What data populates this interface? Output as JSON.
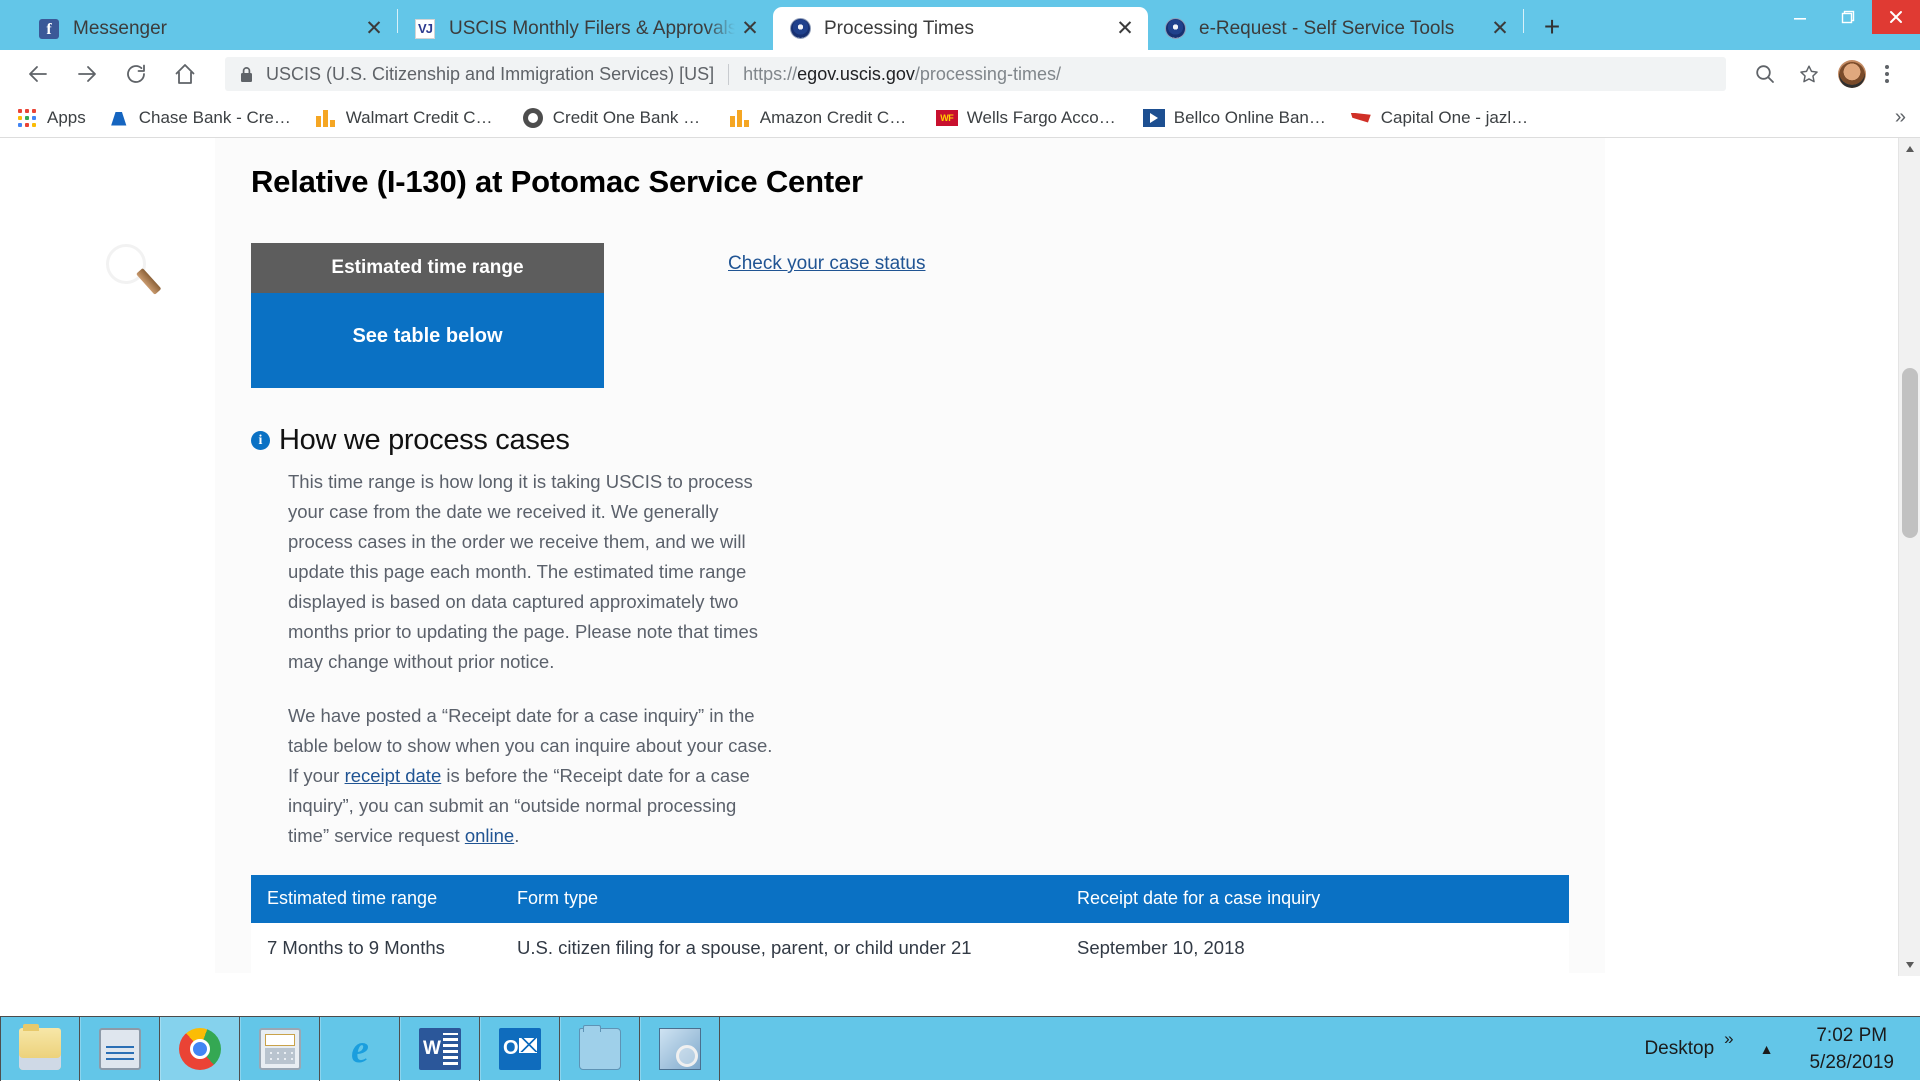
{
  "browser": {
    "tabs": [
      {
        "title": "Messenger",
        "icon": "facebook-icon",
        "active": false
      },
      {
        "title": "USCIS Monthly Filers & Approvals",
        "icon": "vj-icon",
        "active": false
      },
      {
        "title": "Processing Times",
        "icon": "dhs-seal-icon",
        "active": true
      },
      {
        "title": "e-Request - Self Service Tools",
        "icon": "dhs-seal-icon",
        "active": false
      }
    ],
    "new_tab_label": "+",
    "close_label": "✕",
    "window_controls": {
      "minimize": "minimize-icon",
      "maximize": "maximize-icon",
      "close": "close-icon"
    },
    "omnibox": {
      "site_identity": "USCIS (U.S. Citizenship and Immigration Services) [US]",
      "url_scheme": "https://",
      "url_host": "egov.uscis.gov",
      "url_path": "/processing-times/",
      "lock_icon": "lock-icon",
      "zoom_icon": "search-zoom-icon",
      "bookmark_icon": "star-icon",
      "menu_icon": "three-dots-menu-icon"
    },
    "bookmarks": {
      "apps_label": "Apps",
      "items": [
        {
          "label": "Chase Bank - Credit...",
          "icon": "chase-icon"
        },
        {
          "label": "Walmart Credit Car...",
          "icon": "walmart-icon"
        },
        {
          "label": "Credit One Bank Of...",
          "icon": "credit-one-icon"
        },
        {
          "label": "Amazon Credit Car...",
          "icon": "amazon-icon"
        },
        {
          "label": "Wells Fargo Accoun...",
          "icon": "wells-fargo-icon"
        },
        {
          "label": "Bellco Online Banki...",
          "icon": "bellco-icon"
        },
        {
          "label": "Capital One - jazled...",
          "icon": "capital-one-icon"
        }
      ],
      "overflow_label": "»"
    }
  },
  "page": {
    "title": "Relative (I-130) at Potomac Service Center",
    "estimated_range_card": {
      "header": "Estimated time range",
      "value": "See table below"
    },
    "case_status_link": "Check your case status",
    "how_we_process": {
      "heading": "How we process cases",
      "info_icon": "info-icon",
      "paragraph1": "This time range is how long it is taking USCIS to process your case from the date we received it. We generally process cases in the order we receive them, and we will update this page each month. The estimated time range displayed is based on data captured approximately two months prior to updating the page. Please note that times may change without prior notice.",
      "paragraph2_part1": "We have posted a “Receipt date for a case inquiry” in the table below to show when you can inquire about your case. If your ",
      "paragraph2_link1": "receipt date",
      "paragraph2_part2": " is before the “Receipt date for a case inquiry”, you can submit an “outside normal processing time” service request ",
      "paragraph2_link2": "online",
      "paragraph2_part3": "."
    },
    "table": {
      "headers": [
        "Estimated time range",
        "Form type",
        "Receipt date for a case inquiry"
      ],
      "rows": [
        [
          "7 Months to 9 Months",
          "U.S. citizen filing for a spouse, parent, or child under 21",
          "September 10, 2018"
        ]
      ]
    }
  },
  "taskbar": {
    "items": [
      {
        "icon": "file-explorer-icon",
        "running": false
      },
      {
        "icon": "system-monitor-icon",
        "running": false
      },
      {
        "icon": "chrome-icon",
        "running": true
      },
      {
        "icon": "calculator-icon",
        "running": false
      },
      {
        "icon": "internet-explorer-icon",
        "running": false
      },
      {
        "icon": "microsoft-word-icon",
        "running": false
      },
      {
        "icon": "microsoft-outlook-icon",
        "running": false
      },
      {
        "icon": "folder-icon",
        "running": false
      },
      {
        "icon": "search-preview-icon",
        "running": false
      }
    ],
    "desktop_label": "Desktop",
    "overflow_label": "»",
    "show_hidden_label": "▲",
    "time": "7:02 PM",
    "date": "5/28/2019"
  },
  "colors": {
    "accent_blue": "#0a71c4",
    "tab_strip": "#63c6e8",
    "close_red": "#e03a33",
    "link_blue": "#205493",
    "card_header_gray": "#5d5d5d"
  }
}
